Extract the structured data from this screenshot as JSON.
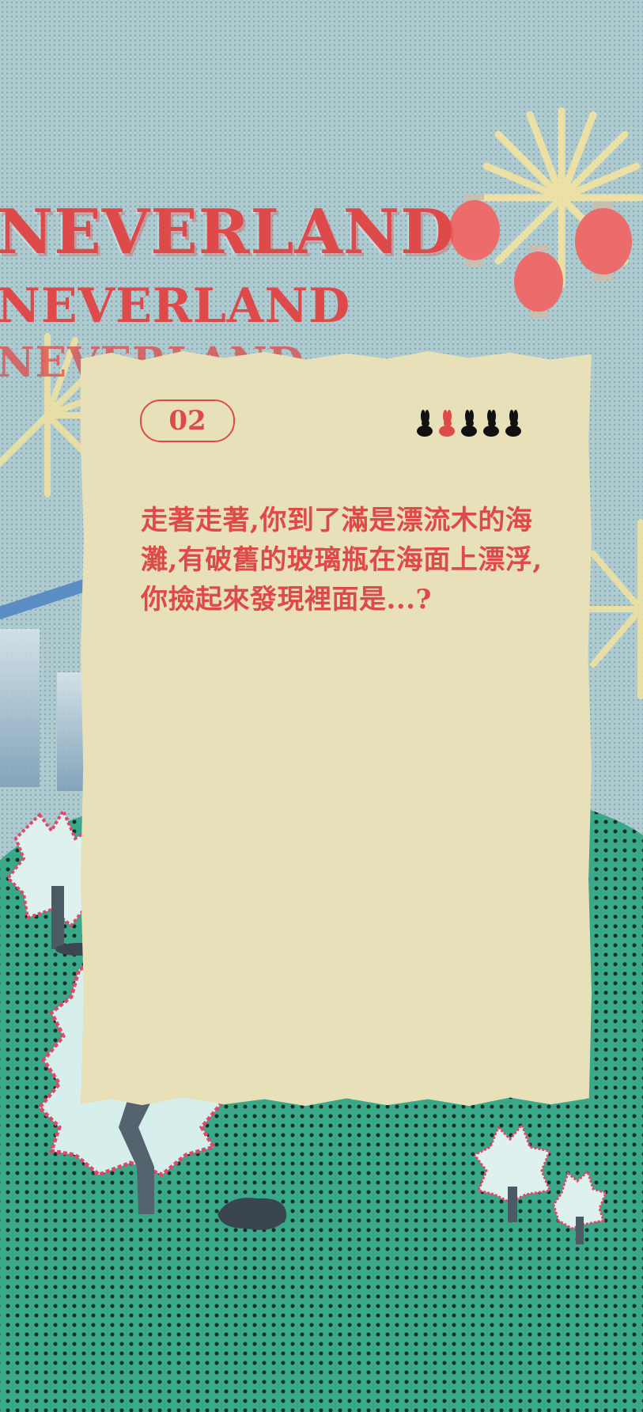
{
  "title_lines": [
    "NEVERLAND",
    "NEVERLAND",
    "NEVERLAND"
  ],
  "card": {
    "badge": "02",
    "rabbits_total": 5,
    "rabbits_highlighted_index": 1,
    "story": "走著走著,你到了滿是漂流木的海灘,有破舊的玻璃瓶在海面上漂浮,你撿起來發現裡面是...?"
  },
  "colors": {
    "accent": "#de4a4a",
    "paper": "#e8e0b8",
    "sky": "#aecbd0",
    "hill": "#3aa98a",
    "rail": "#5b8dc4"
  }
}
